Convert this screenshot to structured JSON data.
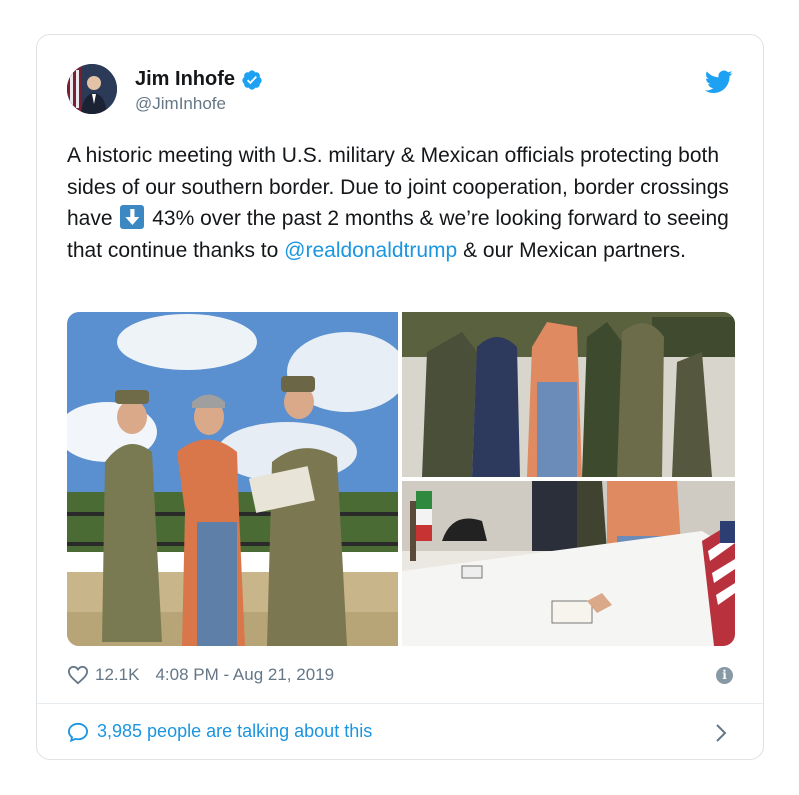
{
  "tweet": {
    "author_name": "Jim Inhofe",
    "author_handle": "@JimInhofe",
    "text_before": "A historic meeting with U.S. military & Mexican officials protecting both sides of our southern border. Due to joint cooperation, border crossings have ",
    "text_after_emoji": " 43% over the past 2 months & we’re looking forward to seeing that continue thanks to ",
    "mention": "@realdonaldtrump",
    "text_end": " & our Mexican partners.",
    "likes": "12.1K",
    "timestamp": "4:08 PM - Aug 21, 2019",
    "talking_about": "3,985 people are talking about this"
  },
  "colors": {
    "accent": "#1b95e0",
    "secondary_text": "#657786",
    "border": "#dfe3e6"
  },
  "icons": {
    "verified": "verified-badge-icon",
    "platform": "twitter-bird-icon",
    "like": "heart-outline-icon",
    "info": "info-icon",
    "reply": "speech-bubble-icon",
    "more": "chevron-right-icon",
    "emoji": "down-arrow-emoji"
  }
}
